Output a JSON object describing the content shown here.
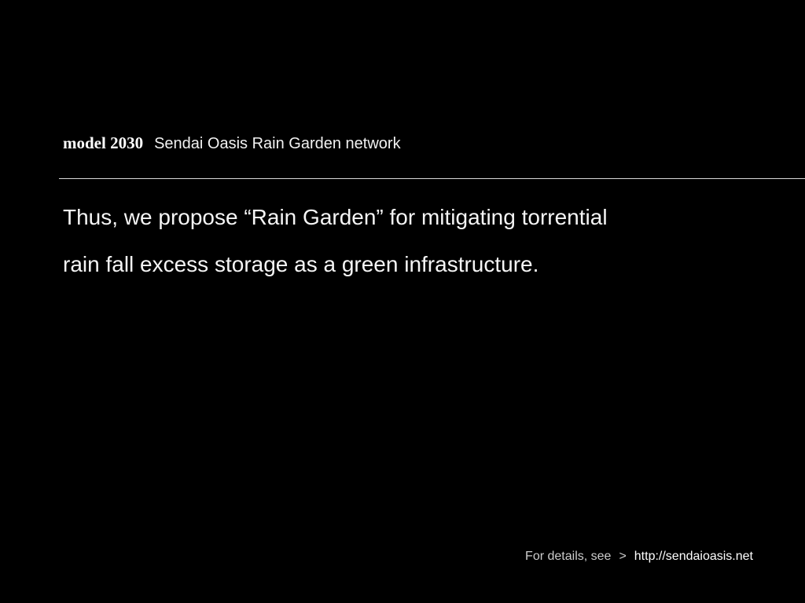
{
  "header": {
    "model_label": "model 2030",
    "subtitle": "Sendai Oasis Rain Garden network"
  },
  "body": {
    "lines": [
      "Thus, we propose “Rain Garden” for mitigating torrential",
      "rain fall excess storage as a green infrastructure."
    ]
  },
  "footer": {
    "label": "For details, see",
    "arrow": ">",
    "link_text": "http://sendaioasis.net"
  },
  "colors": {
    "background": "#000000",
    "text": "#ffffff",
    "divider": "#d9d9d9"
  }
}
